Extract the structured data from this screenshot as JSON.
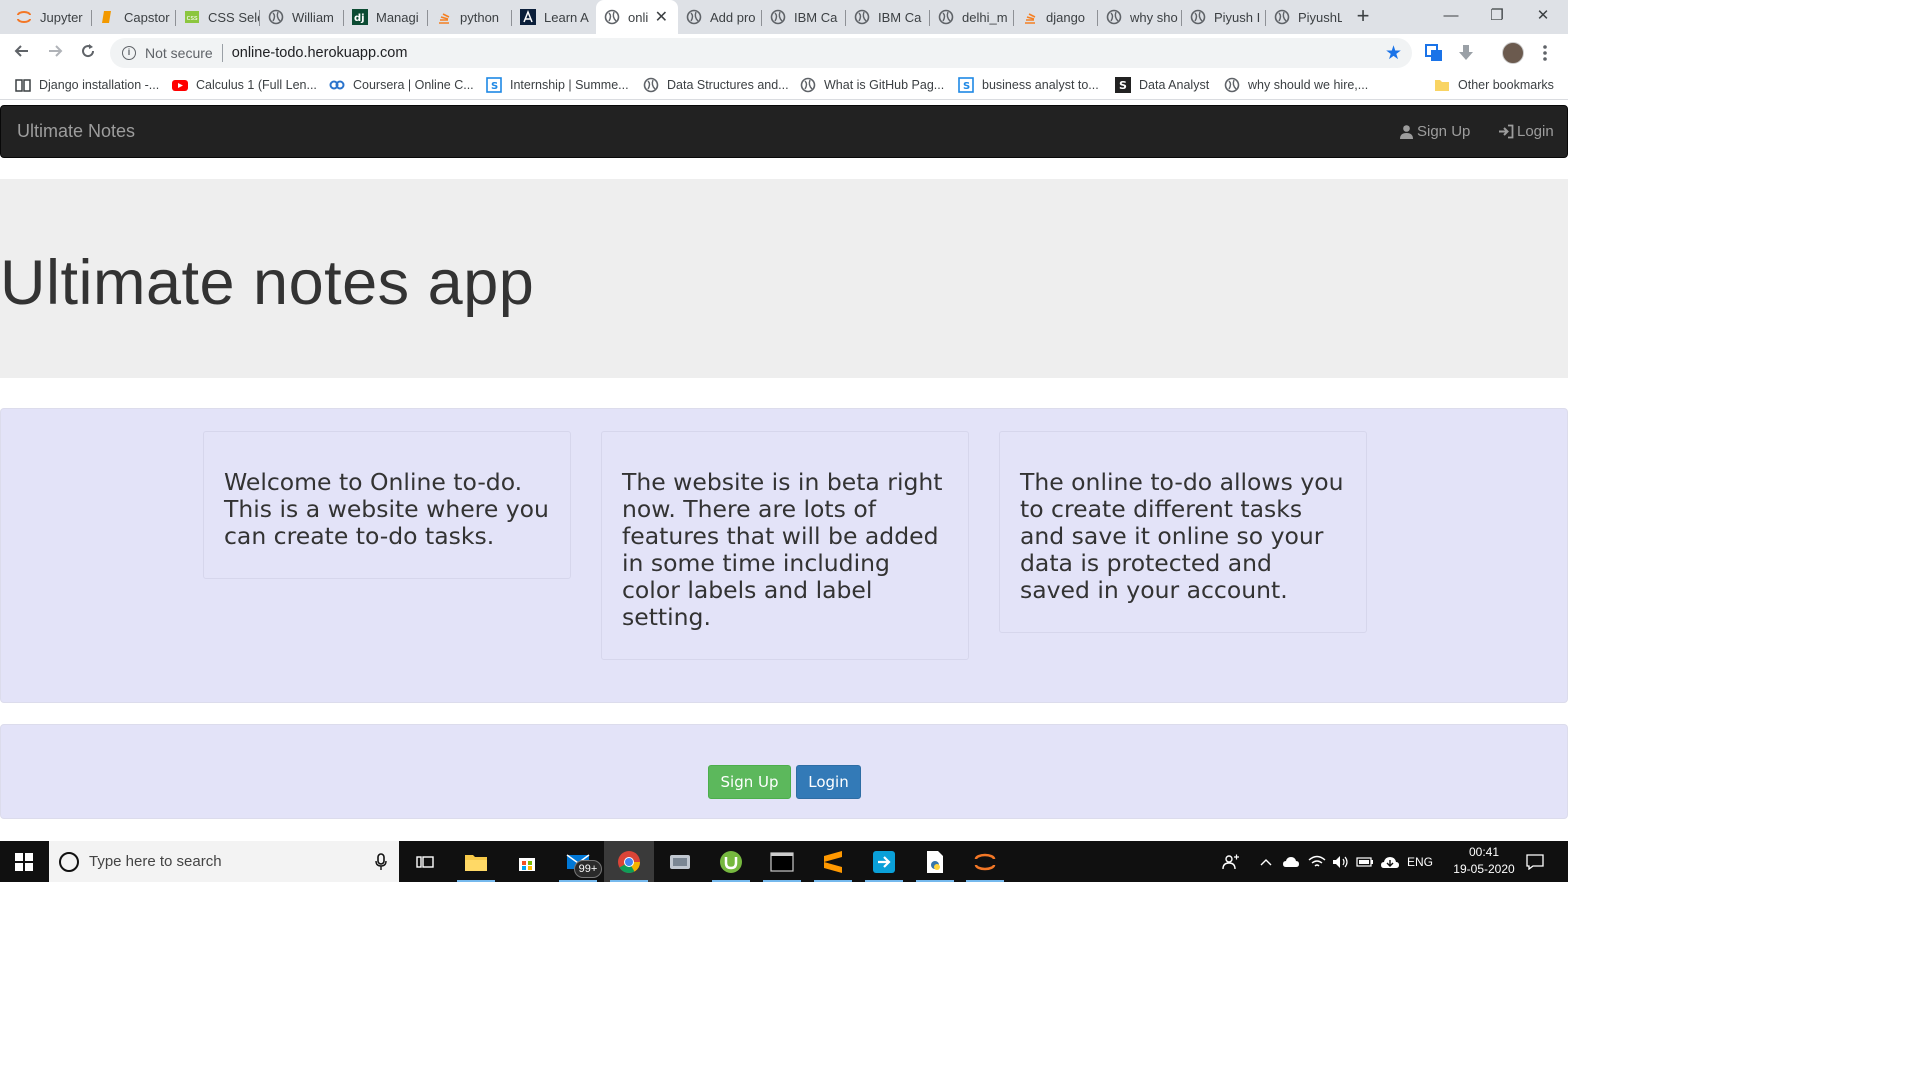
{
  "browser": {
    "tabs": [
      {
        "title": "Jupyter",
        "icon": "jupyter-icon"
      },
      {
        "title": "Capstor",
        "icon": "document-icon"
      },
      {
        "title": "CSS Sele",
        "icon": "css-icon"
      },
      {
        "title": "William",
        "icon": "globe-icon"
      },
      {
        "title": "Managi",
        "icon": "django-icon"
      },
      {
        "title": "python",
        "icon": "stackoverflow-icon"
      },
      {
        "title": "Learn A",
        "icon": "angular-icon"
      },
      {
        "title": "onli",
        "icon": "globe-icon",
        "active": true
      },
      {
        "title": "Add pro",
        "icon": "globe-icon"
      },
      {
        "title": "IBM Ca",
        "icon": "globe-icon"
      },
      {
        "title": "IBM Ca",
        "icon": "globe-icon"
      },
      {
        "title": "delhi_m",
        "icon": "globe-icon"
      },
      {
        "title": "django",
        "icon": "stackoverflow-icon"
      },
      {
        "title": "why sho",
        "icon": "globe-icon"
      },
      {
        "title": "Piyush I",
        "icon": "globe-icon"
      },
      {
        "title": "PiyushL",
        "icon": "globe-icon"
      }
    ],
    "new_tab": "+",
    "window_controls": {
      "minimize": "—",
      "maximize": "❐",
      "close": "✕"
    },
    "address": {
      "security_label": "Not secure",
      "url": "online-todo.herokuapp.com"
    },
    "bookmarks": [
      {
        "label": "Django installation -...",
        "icon": "book-icon"
      },
      {
        "label": "Calculus 1 (Full Len...",
        "icon": "youtube-icon"
      },
      {
        "label": "Coursera | Online C...",
        "icon": "coursera-icon"
      },
      {
        "label": "Internship | Summe...",
        "icon": "internshala-icon"
      },
      {
        "label": "Data Structures and...",
        "icon": "globe-icon"
      },
      {
        "label": "What is GitHub Pag...",
        "icon": "globe-icon"
      },
      {
        "label": "business analyst to...",
        "icon": "internshala-icon"
      },
      {
        "label": "Data Analyst",
        "icon": "scribd-icon"
      },
      {
        "label": "why should we hire,...",
        "icon": "globe-icon"
      }
    ],
    "other_bookmarks": "Other bookmarks"
  },
  "page": {
    "navbar": {
      "brand": "Ultimate Notes",
      "signup": "Sign Up",
      "login": "Login"
    },
    "hero_title": "Ultimate notes app",
    "cards": [
      "Welcome to Online to-do. This is a website where you can create to-do tasks.",
      "The website is in beta right now. There are lots of features that will be added in some time including color labels and label setting.",
      "The online to-do allows you to create different tasks and save it online so your data is protected and saved in your account."
    ],
    "buttons": {
      "signup": "Sign Up",
      "login": "Login"
    }
  },
  "taskbar": {
    "search_placeholder": "Type here to search",
    "mail_badge": "99+",
    "language": "ENG",
    "time": "00:41",
    "date": "19-05-2020"
  },
  "colors": {
    "navbar_bg": "#222222",
    "jumbotron_bg": "#eeeeee",
    "well_bg": "#e3e3f8",
    "success": "#5cb85c",
    "primary": "#337ab7",
    "chrome_accent": "#1a73e8"
  }
}
